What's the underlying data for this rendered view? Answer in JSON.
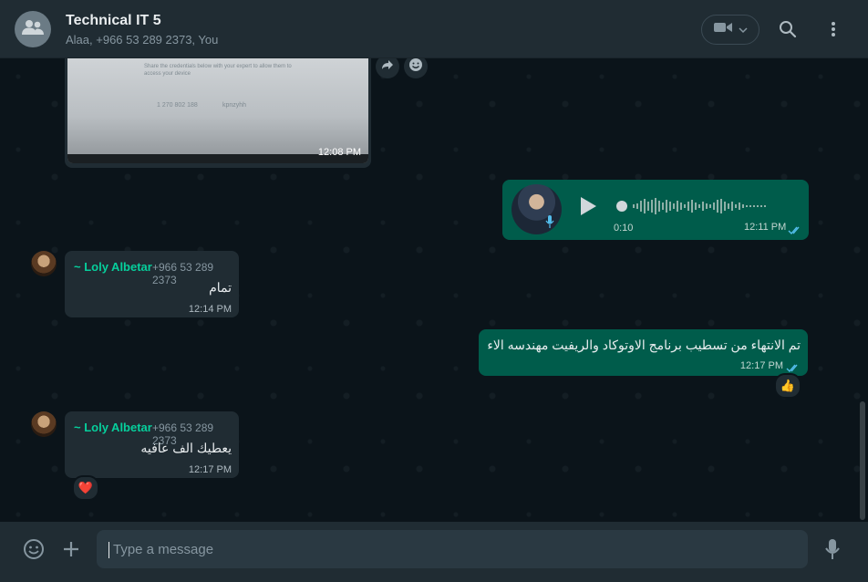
{
  "chat": {
    "title": "Technical IT 5",
    "participants": "Alaa, +966 53 289 2373, You"
  },
  "colors": {
    "header_bg": "#202c33",
    "chat_bg": "#0b141a",
    "incoming_bubble": "#202c33",
    "outgoing_bubble": "#005c4b",
    "sender_name": "#06cf9c",
    "read_ticks": "#53bdeb"
  },
  "messages": {
    "image": {
      "time": "12:08 PM",
      "caption_lines": [
        "Share the credentials below with your expert to allow them to",
        "access your device",
        "1 270 802 188",
        "kpnzyhh"
      ]
    },
    "voice": {
      "duration": "0:10",
      "time": "12:11 PM",
      "status": "read"
    },
    "msg1": {
      "sender": "~ Loly Albetar",
      "phone": "+966 53 289 2373",
      "text": "تمام",
      "time": "12:14 PM"
    },
    "msg2": {
      "text": "تم الانتهاء من تسطيب برنامج الاوتوكاد والريفيت مهندسه الاء",
      "time": "12:17 PM",
      "status": "read",
      "reaction": "👍"
    },
    "msg3": {
      "sender": "~ Loly Albetar",
      "phone": "+966 53 289 2373",
      "text": "يعطيك الف عافيه",
      "time": "12:17 PM",
      "reaction": "❤️"
    }
  },
  "composer": {
    "placeholder": "Type a message"
  },
  "icons": {
    "group_avatar": "group-icon",
    "video": "video-camera-icon",
    "search": "search-icon",
    "menu": "more-vertical-icon",
    "emoji": "emoji-icon",
    "attach": "plus-icon",
    "mic": "microphone-icon",
    "forward": "forward-icon",
    "react": "emoji-react-icon"
  }
}
